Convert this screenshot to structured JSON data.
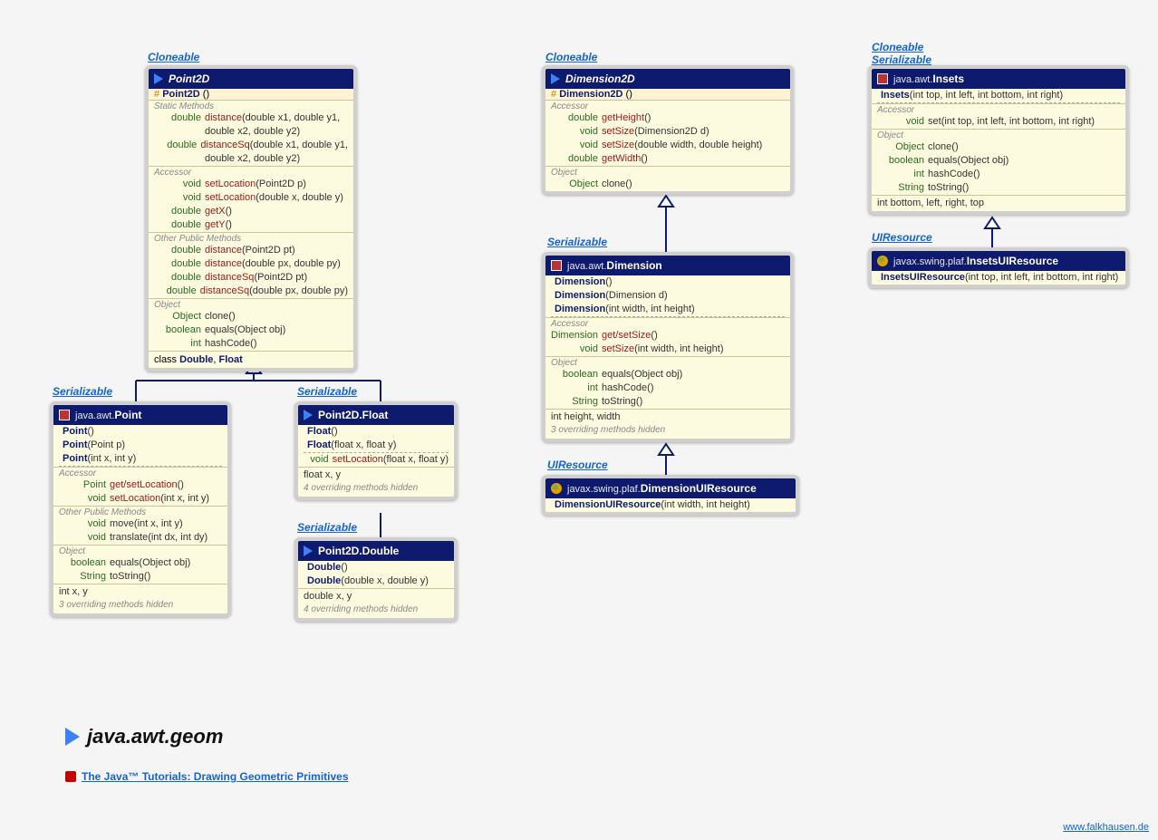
{
  "labels": {
    "cloneable": "Cloneable",
    "serializable": "Serializable",
    "uiresource": "UIResource"
  },
  "point2d": {
    "title": "Point2D",
    "prot": "# Point2D ()",
    "cap_static": "Static Methods",
    "static": [
      {
        "ret": "double",
        "nm": "distance",
        "args": "(double x1, double y1,"
      },
      {
        "ret": "",
        "nm": "",
        "args": "double x2, double y2)"
      },
      {
        "ret": "double",
        "nm": "distanceSq",
        "args": "(double x1, double y1,"
      },
      {
        "ret": "",
        "nm": "",
        "args": "double x2, double y2)"
      }
    ],
    "cap_acc": "Accessor",
    "accessor": [
      {
        "ret": "void",
        "nm": "setLocation",
        "args": "(Point2D p)"
      },
      {
        "ret": "void",
        "nm": "setLocation",
        "args": "(double x, double y)"
      },
      {
        "ret": "double",
        "nm": "getX",
        "args": "()"
      },
      {
        "ret": "double",
        "nm": "getY",
        "args": "()"
      }
    ],
    "cap_other": "Other Public Methods",
    "other": [
      {
        "ret": "double",
        "nm": "distance",
        "args": "(Point2D pt)"
      },
      {
        "ret": "double",
        "nm": "distance",
        "args": "(double px, double py)"
      },
      {
        "ret": "double",
        "nm": "distanceSq",
        "args": "(Point2D pt)"
      },
      {
        "ret": "double",
        "nm": "distanceSq",
        "args": "(double px, double py)"
      }
    ],
    "cap_object": "Object",
    "object": [
      {
        "ret": "Object",
        "nm": "clone",
        "args": "()"
      },
      {
        "ret": "boolean",
        "nm": "equals",
        "args": "(Object obj)"
      },
      {
        "ret": "int",
        "nm": "hashCode",
        "args": "()"
      }
    ],
    "inner": "class Double, Float"
  },
  "point": {
    "pkg": "java.awt.",
    "title": "Point",
    "ctors": [
      {
        "nm": "Point",
        "args": "()"
      },
      {
        "nm": "Point",
        "args": "(Point p)"
      },
      {
        "nm": "Point",
        "args": "(int x, int y)"
      }
    ],
    "cap_acc": "Accessor",
    "accessor": [
      {
        "ret": "Point",
        "nm": "get/setLocation",
        "args": "()"
      },
      {
        "ret": "void",
        "nm": "setLocation",
        "args": "(int x, int y)"
      }
    ],
    "cap_other": "Other Public Methods",
    "other": [
      {
        "ret": "void",
        "nm": "move",
        "args": "(int x, int y)"
      },
      {
        "ret": "void",
        "nm": "translate",
        "args": "(int dx, int dy)"
      }
    ],
    "cap_object": "Object",
    "object": [
      {
        "ret": "boolean",
        "nm": "equals",
        "args": "(Object obj)"
      },
      {
        "ret": "String",
        "nm": "toString",
        "args": "()"
      }
    ],
    "fields": "int x, y",
    "hidden": "3 overriding methods hidden"
  },
  "p2df": {
    "title": "Point2D.Float",
    "ctors": [
      {
        "nm": "Float",
        "args": "()"
      },
      {
        "nm": "Float",
        "args": "(float x, float y)"
      }
    ],
    "method": {
      "ret": "void",
      "nm": "setLocation",
      "args": "(float x, float y)"
    },
    "fields": "float x, y",
    "hidden": "4 overriding methods hidden"
  },
  "p2dd": {
    "title": "Point2D.Double",
    "ctors": [
      {
        "nm": "Double",
        "args": "()"
      },
      {
        "nm": "Double",
        "args": "(double x, double y)"
      }
    ],
    "fields": "double x, y",
    "hidden": "4 overriding methods hidden"
  },
  "dim2d": {
    "title": "Dimension2D",
    "prot": "# Dimension2D ()",
    "cap_acc": "Accessor",
    "accessor": [
      {
        "ret": "double",
        "nm": "getHeight",
        "args": "()"
      },
      {
        "ret": "void",
        "nm": "setSize",
        "args": "(Dimension2D d)"
      },
      {
        "ret": "void",
        "nm": "setSize",
        "args": "(double width, double height)"
      },
      {
        "ret": "double",
        "nm": "getWidth",
        "args": "()"
      }
    ],
    "cap_object": "Object",
    "object": [
      {
        "ret": "Object",
        "nm": "clone",
        "args": "()"
      }
    ]
  },
  "dimension": {
    "pkg": "java.awt.",
    "title": "Dimension",
    "ctors": [
      {
        "nm": "Dimension",
        "args": "()"
      },
      {
        "nm": "Dimension",
        "args": "(Dimension d)"
      },
      {
        "nm": "Dimension",
        "args": "(int width, int height)"
      }
    ],
    "cap_acc": "Accessor",
    "accessor": [
      {
        "ret": "Dimension",
        "nm": "get/setSize",
        "args": "()"
      },
      {
        "ret": "void",
        "nm": "setSize",
        "args": "(int width, int height)"
      }
    ],
    "cap_object": "Object",
    "object": [
      {
        "ret": "boolean",
        "nm": "equals",
        "args": "(Object obj)"
      },
      {
        "ret": "int",
        "nm": "hashCode",
        "args": "()"
      },
      {
        "ret": "String",
        "nm": "toString",
        "args": "()"
      }
    ],
    "fields": "int height, width",
    "hidden": "3 overriding methods hidden"
  },
  "dimuir": {
    "pkg": "javax.swing.plaf.",
    "title": "DimensionUIResource",
    "ctor": {
      "nm": "DimensionUIResource",
      "args": "(int width, int height)"
    }
  },
  "insets": {
    "pkg": "java.awt.",
    "title": "Insets",
    "ctor": {
      "nm": "Insets",
      "args": "(int top, int left, int bottom, int right)"
    },
    "cap_acc": "Accessor",
    "accessor": [
      {
        "ret": "void",
        "nm": "set",
        "args": "(int top, int left, int bottom, int right)"
      }
    ],
    "cap_object": "Object",
    "object": [
      {
        "ret": "Object",
        "nm": "clone",
        "args": "()"
      },
      {
        "ret": "boolean",
        "nm": "equals",
        "args": "(Object obj)"
      },
      {
        "ret": "int",
        "nm": "hashCode",
        "args": "()"
      },
      {
        "ret": "String",
        "nm": "toString",
        "args": "()"
      }
    ],
    "fields": "int bottom, left, right, top"
  },
  "insetsuir": {
    "pkg": "javax.swing.plaf.",
    "title": "InsetsUIResource",
    "ctor": {
      "nm": "InsetsUIResource",
      "args": "(int top, int left, int bottom, int right)"
    }
  },
  "footer": {
    "pkg": "java.awt.geom",
    "link": "The Java™ Tutorials: Drawing Geometric Primitives",
    "watermark": "www.falkhausen.de"
  }
}
